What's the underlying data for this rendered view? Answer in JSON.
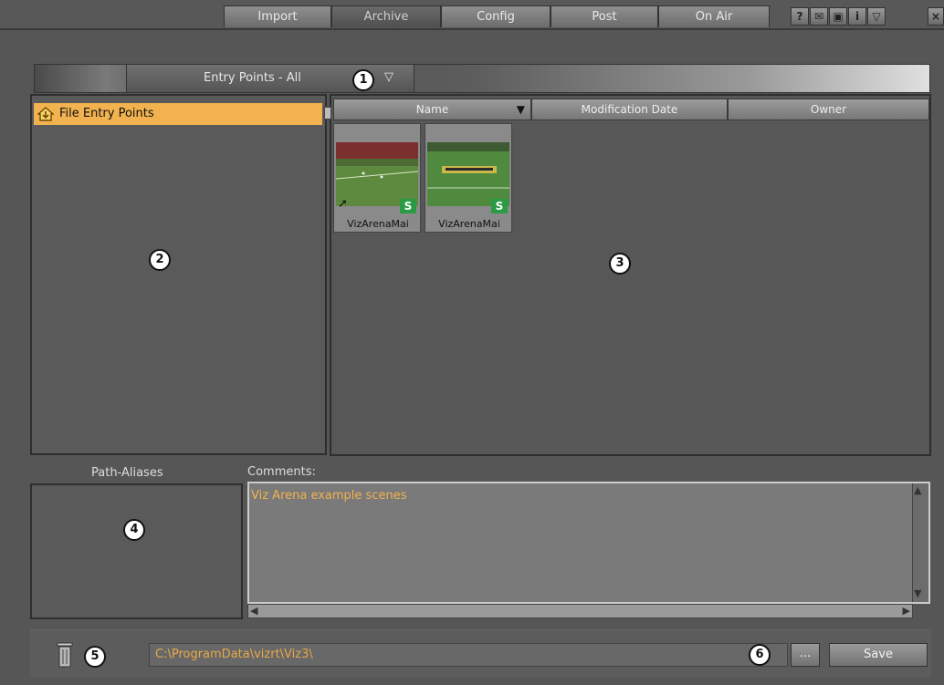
{
  "tabs": [
    {
      "label": "Import"
    },
    {
      "label": "Archive"
    },
    {
      "label": "Config"
    },
    {
      "label": "Post"
    },
    {
      "label": "On Air"
    }
  ],
  "active_tab": "Archive",
  "toolbar_icons": [
    "help-icon",
    "mail-icon",
    "window-icon",
    "info-icon",
    "dropdown-icon",
    "close-icon"
  ],
  "entry_points": {
    "label": "Entry Points - All"
  },
  "tree": {
    "item": "File Entry Points"
  },
  "columns": {
    "name": "Name",
    "modified": "Modification Date",
    "owner": "Owner"
  },
  "items": [
    {
      "label": "VizArenaMai",
      "badge": "S"
    },
    {
      "label": "VizArenaMai",
      "badge": "S"
    }
  ],
  "path_aliases": {
    "title": "Path-Aliases"
  },
  "comments": {
    "label": "Comments:",
    "value": "Viz Arena example scenes"
  },
  "path": {
    "value": "C:\\ProgramData\\vizrt\\Viz3\\"
  },
  "browse_label": "...",
  "save_label": "Save",
  "callouts": [
    "1",
    "2",
    "3",
    "4",
    "5",
    "6"
  ],
  "colors": {
    "highlight": "#f2b24f",
    "badge": "#2b9a45"
  }
}
